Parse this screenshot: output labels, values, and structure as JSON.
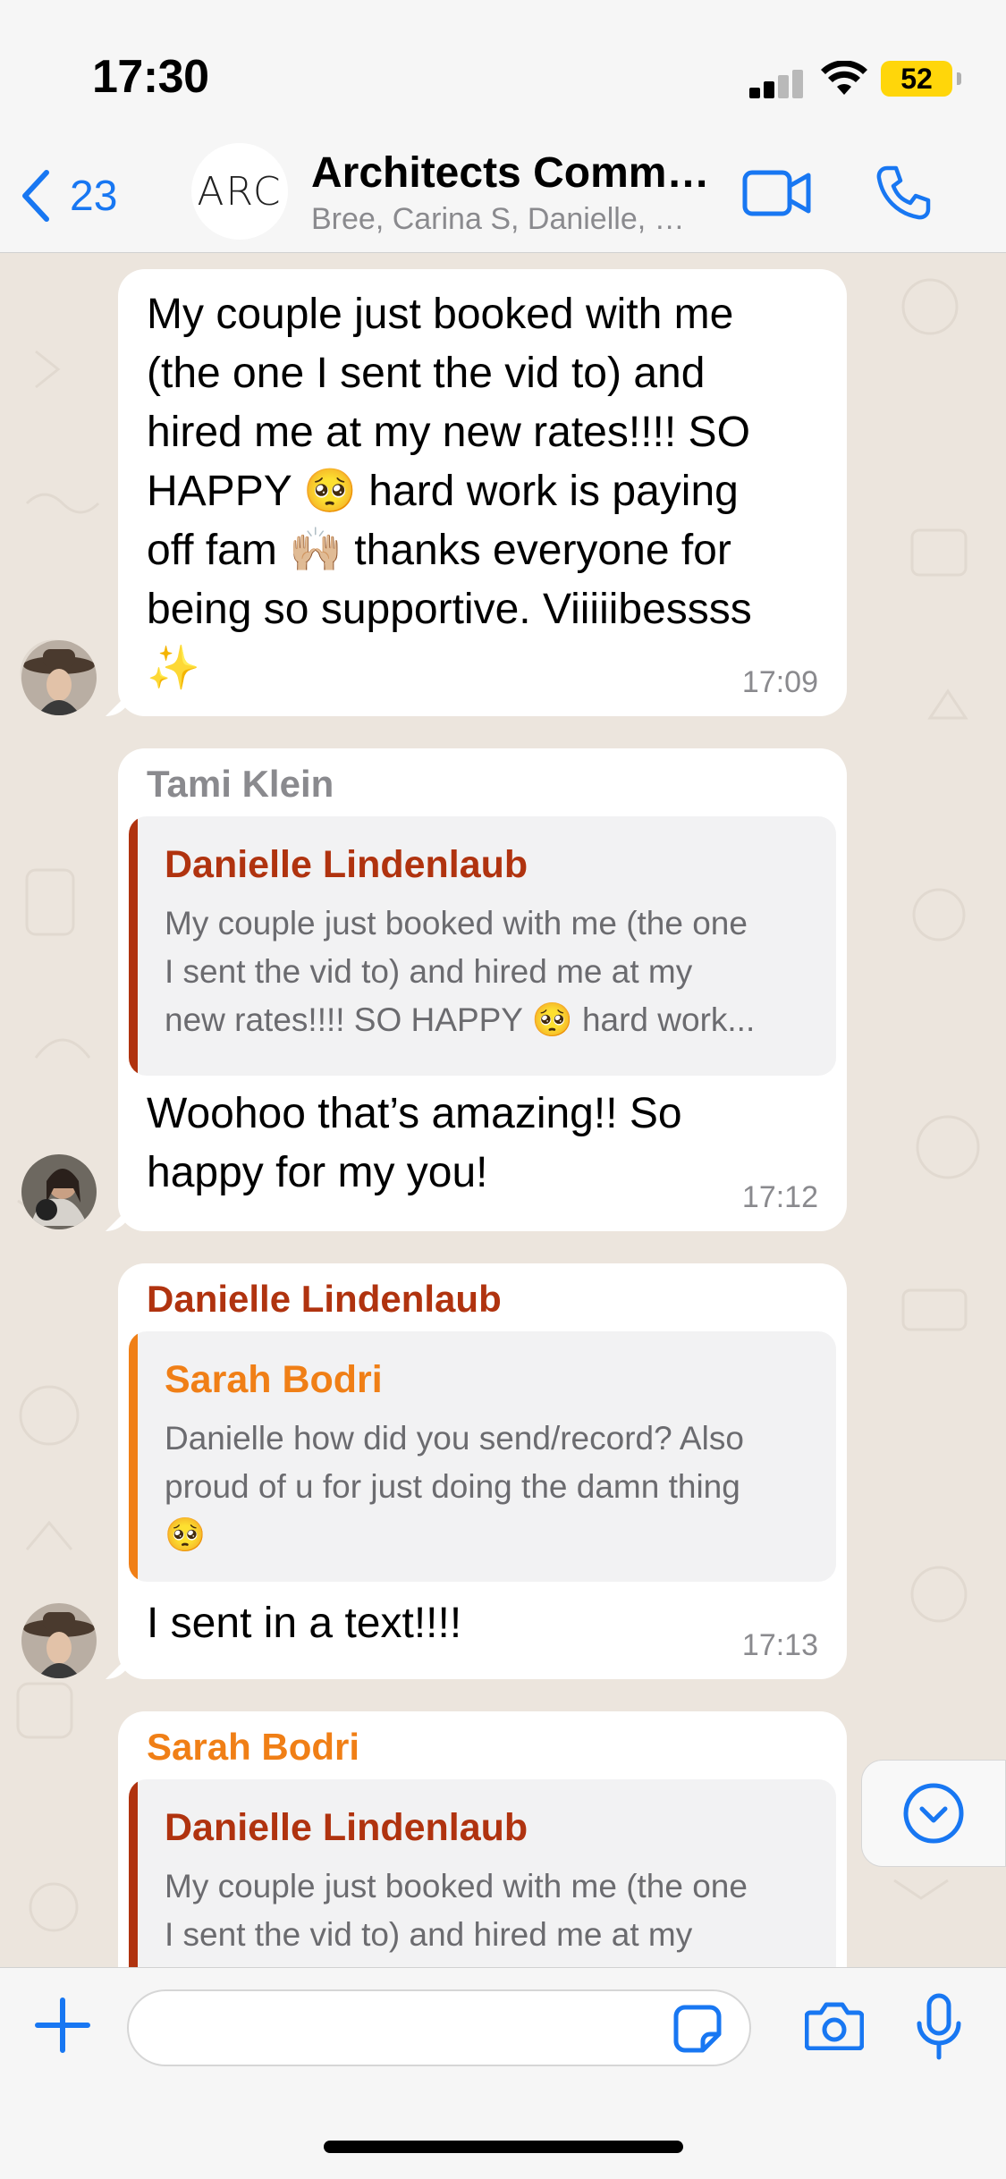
{
  "status_bar": {
    "time": "17:30",
    "battery": "52"
  },
  "header": {
    "back_count": "23",
    "avatar_text": "ARC",
    "title": "Architects Community",
    "subtitle": "Bree, Carina S, Danielle, Sarah, Tami",
    "icons": [
      "chevron-left-icon",
      "video-camera-icon",
      "phone-icon"
    ]
  },
  "messages": [
    {
      "text": "My couple just booked with me (the one I sent the vid to) and hired me at my new rates!!!! SO HAPPY 🥺 hard work is paying off fam 🙌🏼 thanks everyone for being so supportive. Viiiiibessss ✨",
      "lines": [
        "My couple just booked with me",
        "(the one I sent the vid to) and",
        "hired me at my new rates!!!! SO",
        "HAPPY 🥺 hard work is paying",
        "off fam 🙌🏼 thanks everyone for",
        "being so supportive. Viiiiibessss",
        "✨"
      ],
      "time": "17:09"
    },
    {
      "sender": "Tami Klein",
      "quote": {
        "name": "Danielle Lindenlaub",
        "lines": [
          "My couple just booked with me (the one",
          "I sent the vid to) and hired me at my",
          "new rates!!!! SO HAPPY 🥺 hard work..."
        ]
      },
      "lines": [
        "Woohoo that’s amazing!! So",
        "happy for my you!"
      ],
      "time": "17:12"
    },
    {
      "sender": "Danielle Lindenlaub",
      "quote": {
        "name": "Sarah Bodri",
        "lines": [
          "Danielle how did you send/record? Also",
          "proud of u for just doing the damn thing",
          "🥺"
        ]
      },
      "lines": [
        "I sent in a text!!!!"
      ],
      "time": "17:13"
    },
    {
      "sender": "Sarah Bodri",
      "quote": {
        "name": "Danielle Lindenlaub",
        "lines": [
          "My couple just booked with me (the one",
          "I sent the vid to) and hired me at my"
        ]
      }
    }
  ],
  "colors": {
    "accent": "#1877f2",
    "chat_bg": "#ece5dd",
    "danielle": "#b0330f",
    "sarah": "#f07f16",
    "tami": "#8a8a8e"
  },
  "composer": {
    "placeholder": ""
  }
}
